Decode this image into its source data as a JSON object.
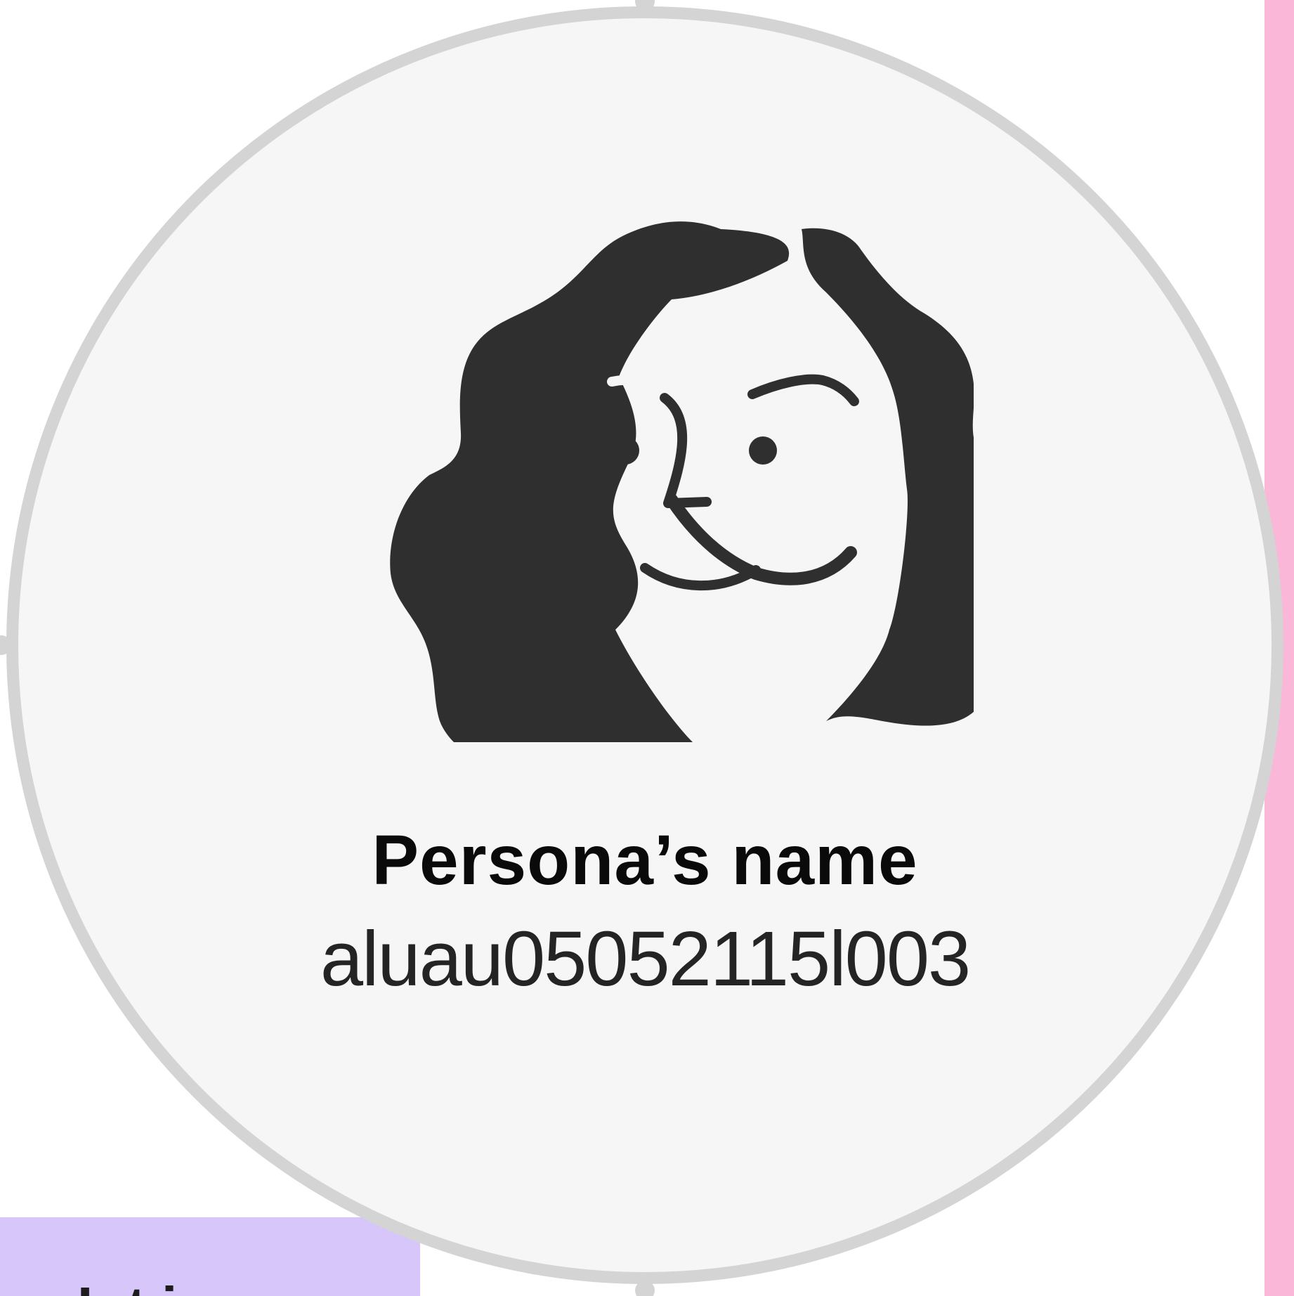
{
  "persona": {
    "name": "Persona’s name",
    "id": "aluau05052115l003"
  },
  "sticky_note": {
    "partial_text": "Int   i"
  },
  "avatar": {
    "icon": "woman-face-icon",
    "fill_color": "#2f2f2f"
  },
  "colors": {
    "card_background": "#f6f6f6",
    "card_border": "#d4d4d4",
    "sticky_purple": "#d6c6f9",
    "sticky_pink": "#fbb7d7"
  }
}
